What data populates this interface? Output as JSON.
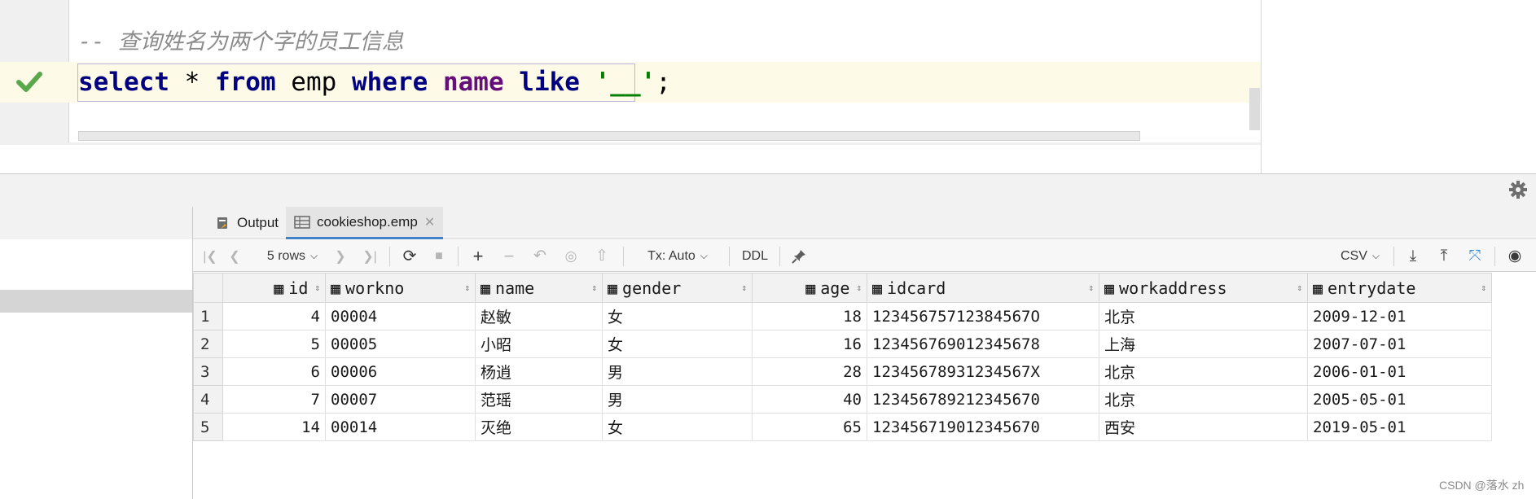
{
  "editor": {
    "comment": "-- 查询姓名为两个字的员工信息",
    "code_tokens": {
      "select": "select",
      "star": " * ",
      "from": "from",
      "table": " emp ",
      "where": "where",
      "sp1": " ",
      "column": "name",
      "sp2": " ",
      "like": "like",
      "sp3": " ",
      "pattern": "'__'",
      "semicolon": ";"
    },
    "status_icon": "check-icon",
    "colors": {
      "keyword": "#000080",
      "column": "#660e7a",
      "string": "#008000",
      "comment": "#8c8c8c",
      "caret_line": "#fdfae8"
    }
  },
  "panel": {
    "tabs": [
      {
        "label": "Output",
        "icon": "output-icon"
      },
      {
        "label": "cookieshop.emp",
        "icon": "table-icon",
        "active": true
      }
    ],
    "settings_icon": "gear-icon"
  },
  "toolbar": {
    "rows_label": "5 rows",
    "tx_label": "Tx: Auto",
    "ddl_label": "DDL",
    "csv_label": "CSV",
    "icons": [
      "first-page-icon",
      "prev-page-icon",
      "next-page-icon",
      "last-page-icon",
      "refresh-icon",
      "stop-icon",
      "add-row-icon",
      "delete-row-icon",
      "revert-icon",
      "preview-changes-icon",
      "submit-icon",
      "pin-icon",
      "export-icon",
      "import-icon",
      "compare-icon",
      "view-icon"
    ]
  },
  "grid": {
    "columns": [
      "id",
      "workno",
      "name",
      "gender",
      "age",
      "idcard",
      "workaddress",
      "entrydate"
    ],
    "rows": [
      [
        "1",
        "4",
        "00004",
        "赵敏",
        "女",
        "18",
        "12345675712384567O",
        "北京",
        "2009-12-01"
      ],
      [
        "2",
        "5",
        "00005",
        "小昭",
        "女",
        "16",
        "123456769012345678",
        "上海",
        "2007-07-01"
      ],
      [
        "3",
        "6",
        "00006",
        "杨逍",
        "男",
        "28",
        "12345678931234567X",
        "北京",
        "2006-01-01"
      ],
      [
        "4",
        "7",
        "00007",
        "范瑶",
        "男",
        "40",
        "123456789212345670",
        "北京",
        "2005-05-01"
      ],
      [
        "5",
        "14",
        "00014",
        "灭绝",
        "女",
        "65",
        "123456719012345670",
        "西安",
        "2019-05-01"
      ]
    ]
  },
  "watermark": "CSDN @落水 zh"
}
